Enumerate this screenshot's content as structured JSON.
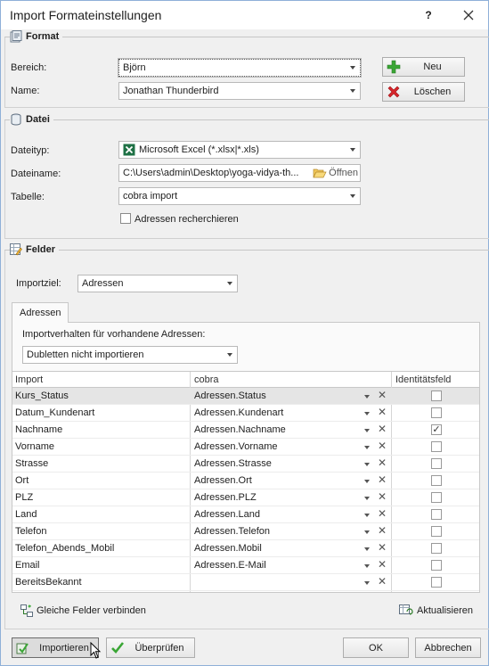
{
  "window": {
    "title": "Import Formateinstellungen",
    "help": "?",
    "close_icon": "close-icon"
  },
  "format": {
    "title": "Format",
    "bereich_label": "Bereich:",
    "bereich_value": "Björn",
    "name_label": "Name:",
    "name_value": "Jonathan Thunderbird",
    "neu_label": "Neu",
    "loeschen_label": "Löschen"
  },
  "datei": {
    "title": "Datei",
    "dateityp_label": "Dateityp:",
    "dateityp_value": "Microsoft Excel (*.xlsx|*.xls)",
    "dateiname_label": "Dateiname:",
    "dateiname_value": "C:\\Users\\admin\\Desktop\\yoga-vidya-th...",
    "oeffnen_label": "Öffnen",
    "tabelle_label": "Tabelle:",
    "tabelle_value": "cobra import",
    "recherche_label": "Adressen recherchieren"
  },
  "felder": {
    "title": "Felder",
    "importziel_label": "Importziel:",
    "importziel_value": "Adressen",
    "tab_label": "Adressen",
    "verhalten_label": "Importverhalten für vorhandene Adressen:",
    "verhalten_value": "Dubletten nicht importieren",
    "columns": [
      "Import",
      "cobra",
      "Identitätsfeld"
    ],
    "rows": [
      {
        "import": "Kurs_Status",
        "cobra": "Adressen.Status",
        "identity": ""
      },
      {
        "import": "Datum_Kundenart",
        "cobra": "Adressen.Kundenart",
        "identity": ""
      },
      {
        "import": "Nachname",
        "cobra": "Adressen.Nachname",
        "identity": "✓"
      },
      {
        "import": "Vorname",
        "cobra": "Adressen.Vorname",
        "identity": ""
      },
      {
        "import": "Strasse",
        "cobra": "Adressen.Strasse",
        "identity": ""
      },
      {
        "import": "Ort",
        "cobra": "Adressen.Ort",
        "identity": ""
      },
      {
        "import": "PLZ",
        "cobra": "Adressen.PLZ",
        "identity": ""
      },
      {
        "import": "Land",
        "cobra": "Adressen.Land",
        "identity": ""
      },
      {
        "import": "Telefon",
        "cobra": "Adressen.Telefon",
        "identity": ""
      },
      {
        "import": "Telefon_Abends_Mobil",
        "cobra": "Adressen.Mobil",
        "identity": ""
      },
      {
        "import": "Email",
        "cobra": "Adressen.E-Mail",
        "identity": ""
      },
      {
        "import": "BereitsBekannt",
        "cobra": "",
        "identity": ""
      }
    ],
    "gleiche_label": "Gleiche Felder verbinden",
    "aktualisieren_label": "Aktualisieren"
  },
  "footer": {
    "importieren_label": "Importieren",
    "ueberpruefen_label": "Überprüfen",
    "ok_label": "OK",
    "abbrechen_label": "Abbrechen"
  }
}
